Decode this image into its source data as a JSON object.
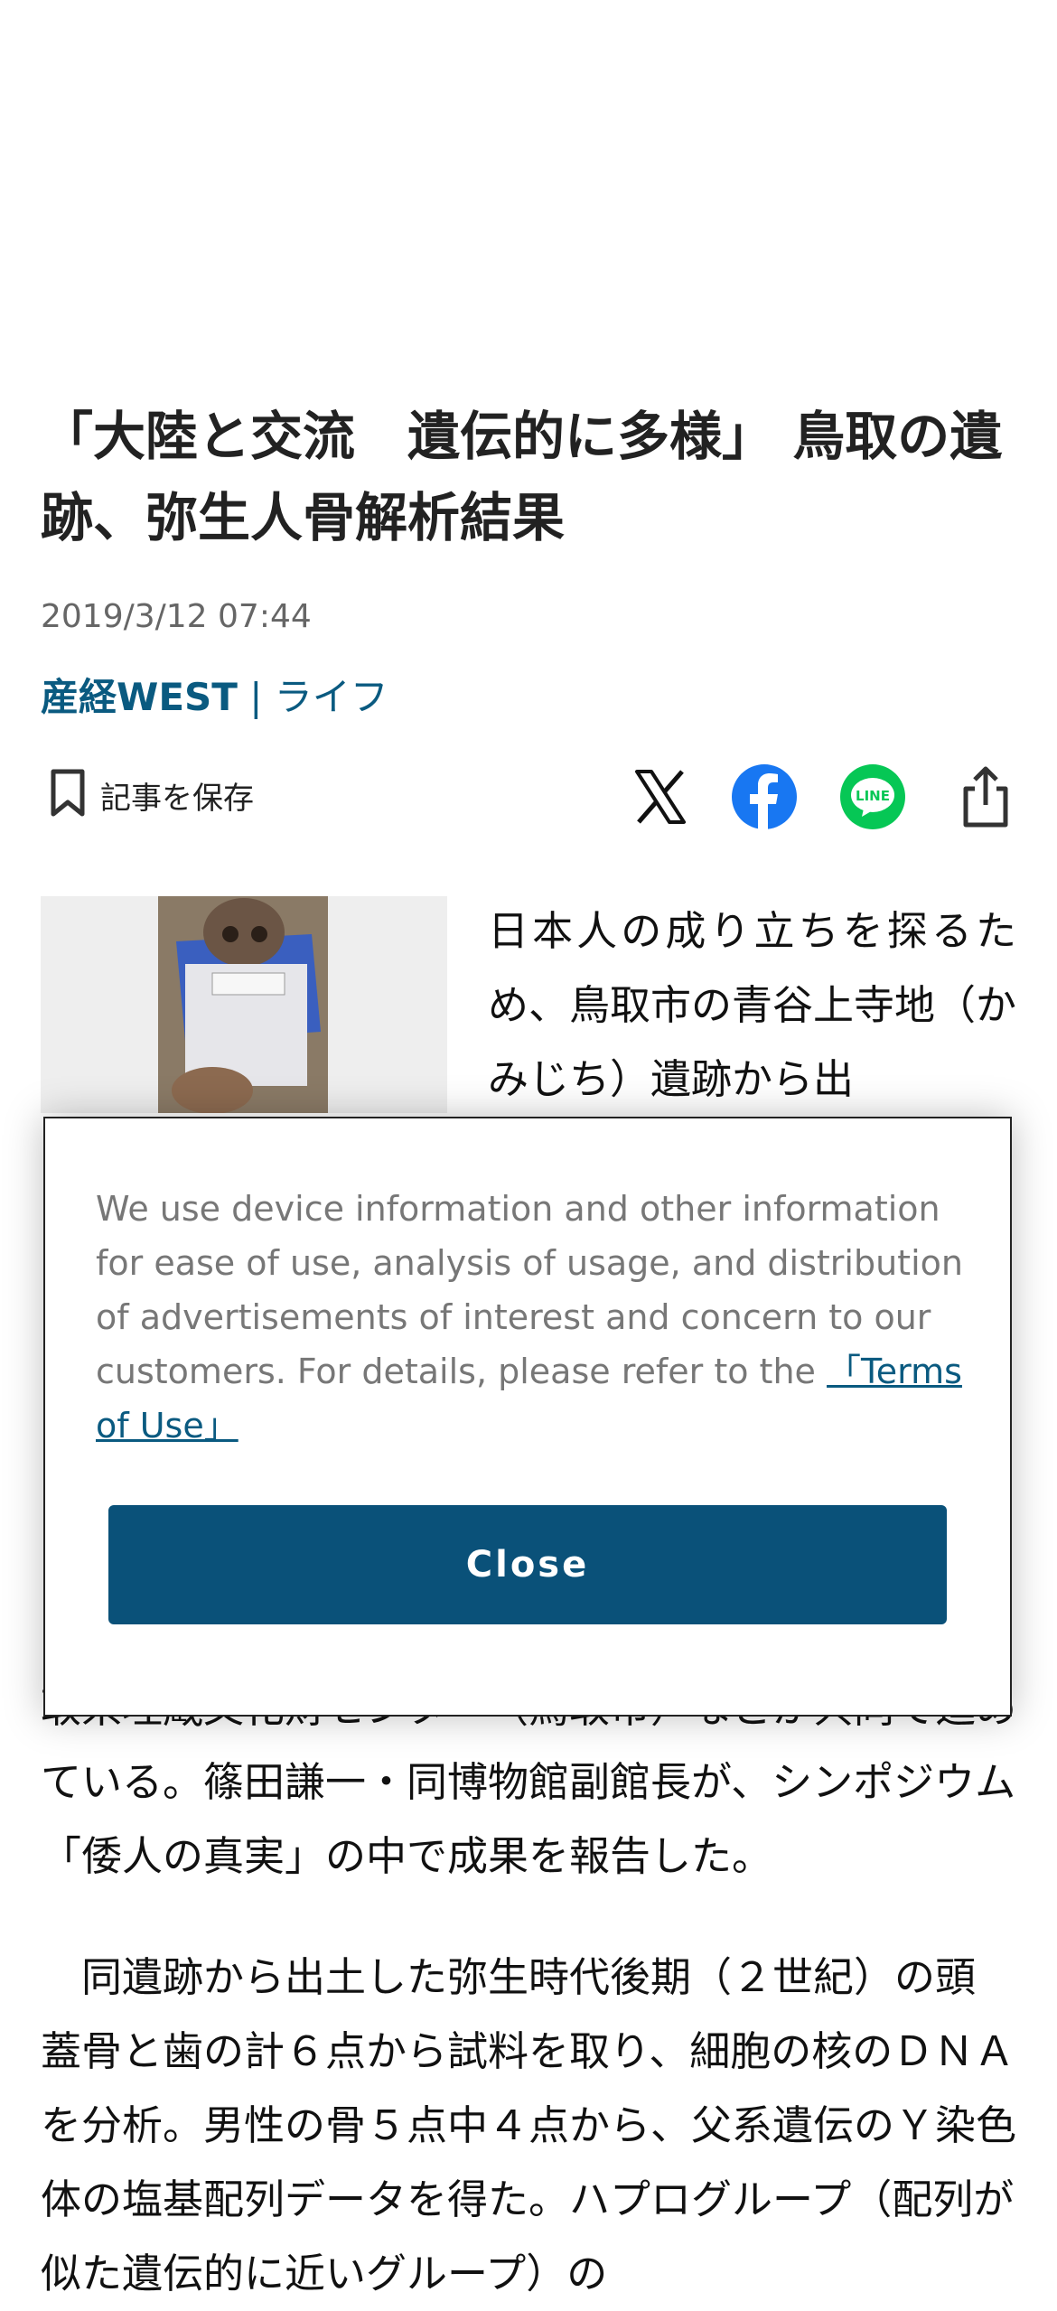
{
  "article": {
    "headline": "「大陸と交流　遺伝的に多様」 鳥取の遺跡、弥生人骨解析結果",
    "date": "2019/3/12 07:44",
    "brand": "産経WEST",
    "separator": "|",
    "category": "ライフ",
    "intro": "日本人の成り立ちを探るため、鳥取市の青谷上寺地（かみじち）遺跡から出",
    "body_partial": "取県埋蔵文化財センター（鳥取市）などが共同で進めている。篠田謙一・同博物館副館長が、シンポジウム「倭人の真実」の中で成果を報告した。",
    "paragraph2": "同遺跡から出土した弥生時代後期（２世紀）の頭蓋骨と歯の計６点から試料を取り、細胞の核のＤＮＡを分析。男性の骨５点中４点から、父系遺伝のＹ染色体の塩基配列データを得た。ハプログループ（配列が似た遺伝的に近いグループ）の"
  },
  "toolbar": {
    "save_label": "記事を保存",
    "save_icon": "bookmark-icon",
    "share_icons": [
      "x-icon",
      "facebook-icon",
      "line-icon",
      "share-icon"
    ],
    "line_text": "LINE"
  },
  "consent": {
    "message": "We use device information and other information for ease of use, analysis of usage, and distribution of advertisements of interest and concern to our customers. For details, please refer to the",
    "link_text": "「Terms of Use」",
    "close_label": "Close"
  },
  "colors": {
    "brand": "#0a5a80",
    "close_button": "#0a5179",
    "facebook": "#1877f2",
    "line": "#06c755"
  }
}
